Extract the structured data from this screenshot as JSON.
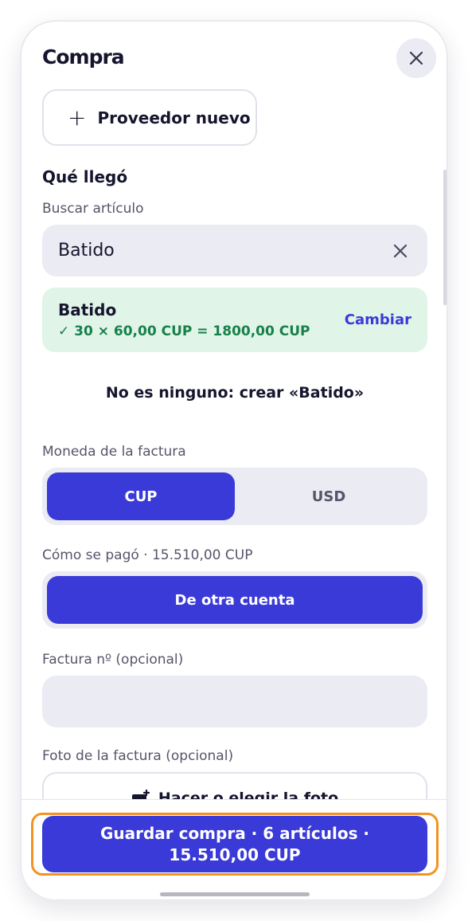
{
  "header": {
    "title": "Compra",
    "close_icon": "close-icon"
  },
  "new_provider": {
    "icon": "plus-icon",
    "label": "Proveedor nuevo"
  },
  "what_arrived": {
    "section_title": "Qué llegó",
    "search_label": "Buscar artículo",
    "search_value": "Batido",
    "selected": {
      "name": "Batido",
      "calculation": "✓ 30 × 60,00 CUP = 1800,00 CUP",
      "change_label": "Cambiar"
    },
    "create_new": "No es ninguno: crear «Batido»"
  },
  "currency": {
    "label": "Moneda de la factura",
    "options": [
      "CUP",
      "USD"
    ],
    "selected": "CUP"
  },
  "payment": {
    "label": "Cómo se pagó · 15.510,00 CUP",
    "method": "De otra cuenta"
  },
  "invoice_number": {
    "label": "Factura nº (opcional)",
    "value": ""
  },
  "invoice_photo": {
    "label": "Foto de la factura (opcional)",
    "button_label": "Hacer o elegir la foto",
    "icon": "add-photo-icon"
  },
  "footer": {
    "save_label": "Guardar compra · 6 artículos · 15.510,00 CUP"
  },
  "colors": {
    "accent": "#3a3ad8",
    "success": "#17804a",
    "highlight": "#f39322",
    "field_bg": "#ebebf3"
  }
}
